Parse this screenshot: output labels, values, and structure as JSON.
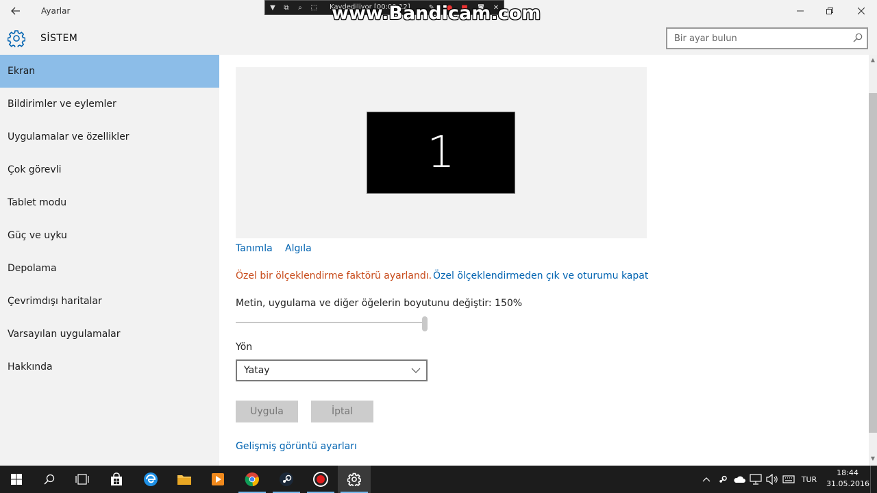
{
  "window": {
    "title": "Ayarlar",
    "section": "SİSTEM"
  },
  "search": {
    "placeholder": "Bir ayar bulun"
  },
  "sidebar": {
    "items": [
      {
        "label": "Ekran",
        "active": true
      },
      {
        "label": "Bildirimler ve eylemler"
      },
      {
        "label": "Uygulamalar ve özellikler"
      },
      {
        "label": "Çok görevli"
      },
      {
        "label": "Tablet modu"
      },
      {
        "label": "Güç ve uyku"
      },
      {
        "label": "Depolama"
      },
      {
        "label": "Çevrimdışı haritalar"
      },
      {
        "label": "Varsayılan uygulamalar"
      },
      {
        "label": "Hakkında"
      }
    ]
  },
  "display": {
    "monitor_number": "1",
    "identify_link": "Tanımla",
    "detect_link": "Algıla",
    "custom_scale_warning": "Özel bir ölçeklendirme faktörü ayarlandı.",
    "signout_link": "Özel ölçeklendirmeden çık ve oturumu kapat",
    "scale_label": "Metin, uygulama ve diğer öğelerin boyutunu değiştir: 150%",
    "scale_slider_fraction": 1.0,
    "orientation_label": "Yön",
    "orientation_value": "Yatay",
    "apply_label": "Uygula",
    "cancel_label": "İptal",
    "advanced_link": "Gelişmiş görüntü ayarları"
  },
  "recorder": {
    "status_text": "Kaydediliyor  [00:00:12]",
    "watermark": "www.Bandicam.com"
  },
  "taskbar": {
    "language": "TUR",
    "time": "18:44",
    "date": "31.05.2016"
  },
  "colors": {
    "accent": "#0063b1",
    "selected_nav": "#8cbde8",
    "warning": "#c84b1b"
  }
}
